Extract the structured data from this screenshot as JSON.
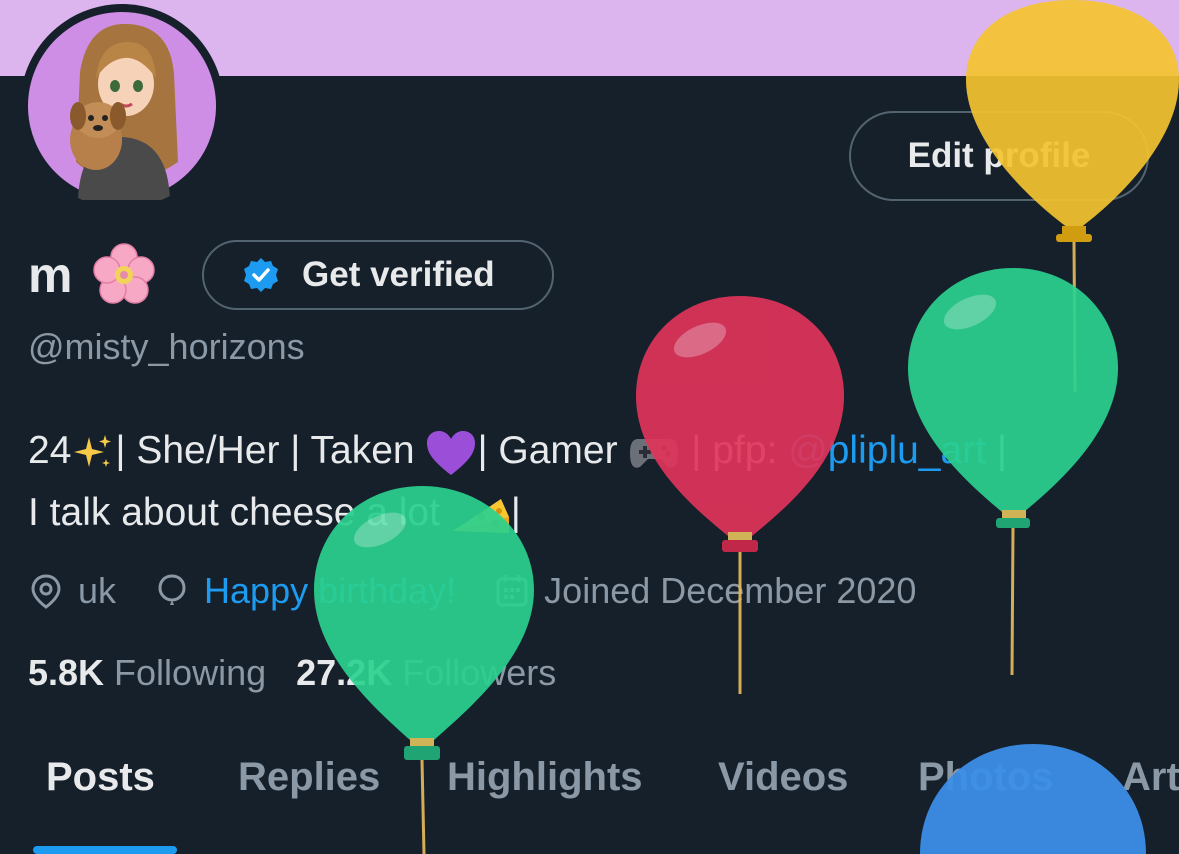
{
  "profile": {
    "name": "m",
    "name_emoji": "cherry-blossom-icon",
    "verify_label": "Get verified",
    "handle": "@misty_horizons",
    "edit_label": "Edit profile"
  },
  "bio": {
    "part1": "24",
    "part2": "| She/Her | Taken ",
    "part3": "| Gamer ",
    "part4": " | pfp: ",
    "link": "@pliplu_art",
    "part5": " |",
    "line2": "I talk about cheese a lot ",
    "part6": "|"
  },
  "meta": {
    "location": "uk",
    "birthday": "Happy birthday!",
    "joined": "Joined December 2020"
  },
  "stats": {
    "following_count": "5.8K",
    "following_label": "Following",
    "followers_count": "27.2K",
    "followers_label": "Followers"
  },
  "tabs": [
    "Posts",
    "Replies",
    "Highlights",
    "Videos",
    "Photos",
    "Art"
  ],
  "colors": {
    "background": "#15202b",
    "banner": "#dcb4ee",
    "accent": "#1d9bf0",
    "muted": "#8b98a5",
    "balloon_yellow": "#f4c430",
    "balloon_green": "#2bd18f",
    "balloon_red": "#e0345a",
    "balloon_blue": "#3b8ee8"
  }
}
